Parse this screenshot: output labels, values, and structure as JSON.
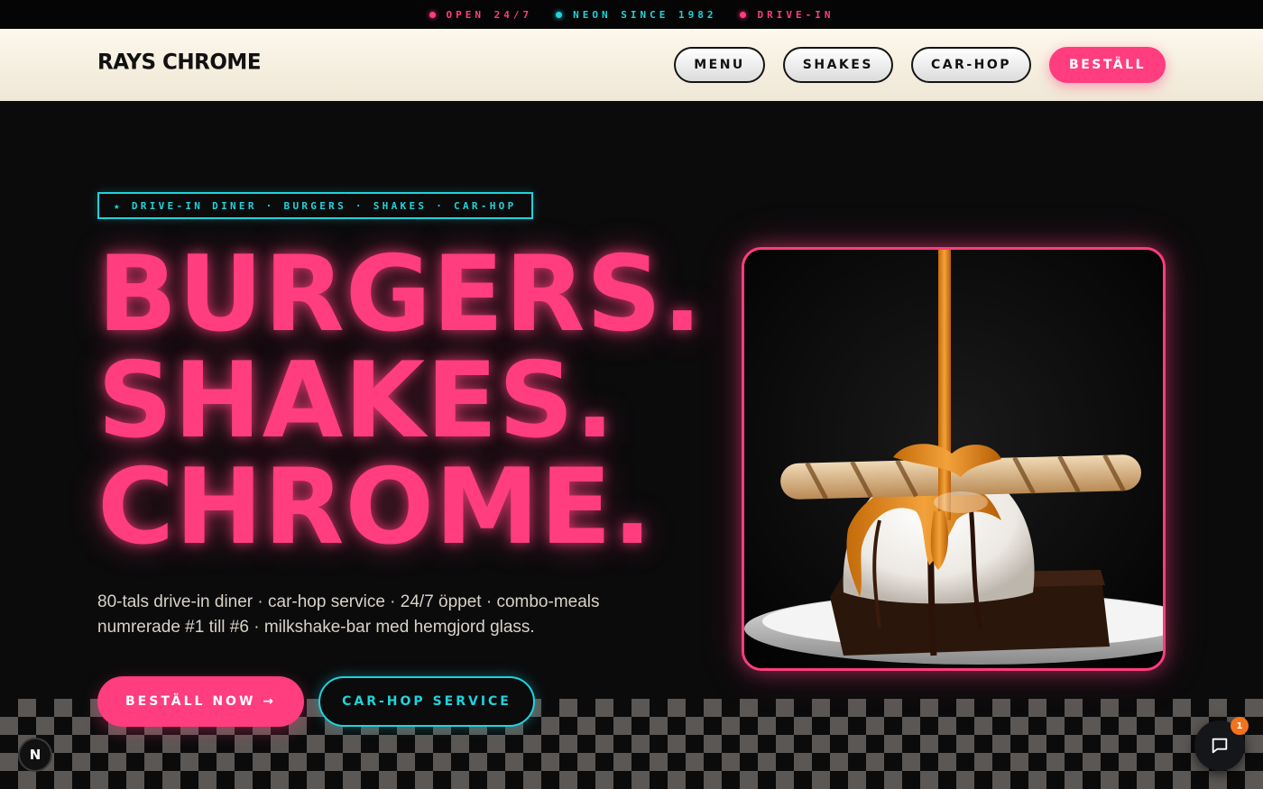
{
  "ticker": {
    "items": [
      {
        "label": "OPEN 24/7",
        "color": "#ff3d7f",
        "text_color": "#ff3d7f"
      },
      {
        "label": "NEON SINCE 1982",
        "color": "#20d3dc",
        "text_color": "#20d3dc"
      },
      {
        "label": "DRIVE-IN",
        "color": "#ff3d7f",
        "text_color": "#ff3d7f"
      }
    ]
  },
  "header": {
    "logo": "RAYS CHROME",
    "nav": [
      {
        "label": "MENU"
      },
      {
        "label": "SHAKES"
      },
      {
        "label": "CAR-HOP"
      }
    ],
    "cta_label": "BESTÄLL"
  },
  "hero": {
    "tag": "★  DRIVE-IN DINER · BURGERS · SHAKES · CAR-HOP",
    "headline": [
      "BURGERS.",
      "SHAKES.",
      "CHROME."
    ],
    "description": "80-tals drive-in diner · car-hop service · 24/7 öppet · combo-meals numrerade #1 till #6 · milkshake-bar med hemgjord glass.",
    "primary_button": "BESTÄLL NOW  →",
    "secondary_button": "CAR-HOP SERVICE",
    "image_icon": "ice-cream-brownie-photo"
  },
  "widgets": {
    "badge_letter": "N",
    "chat_icon": "chat-bubble-icon",
    "chat_count": "1"
  },
  "colors": {
    "accent_pink": "#ff3d7f",
    "accent_cyan": "#20d3dc",
    "background": "#0b0b0c",
    "header_bg": "#fdf8ec"
  }
}
